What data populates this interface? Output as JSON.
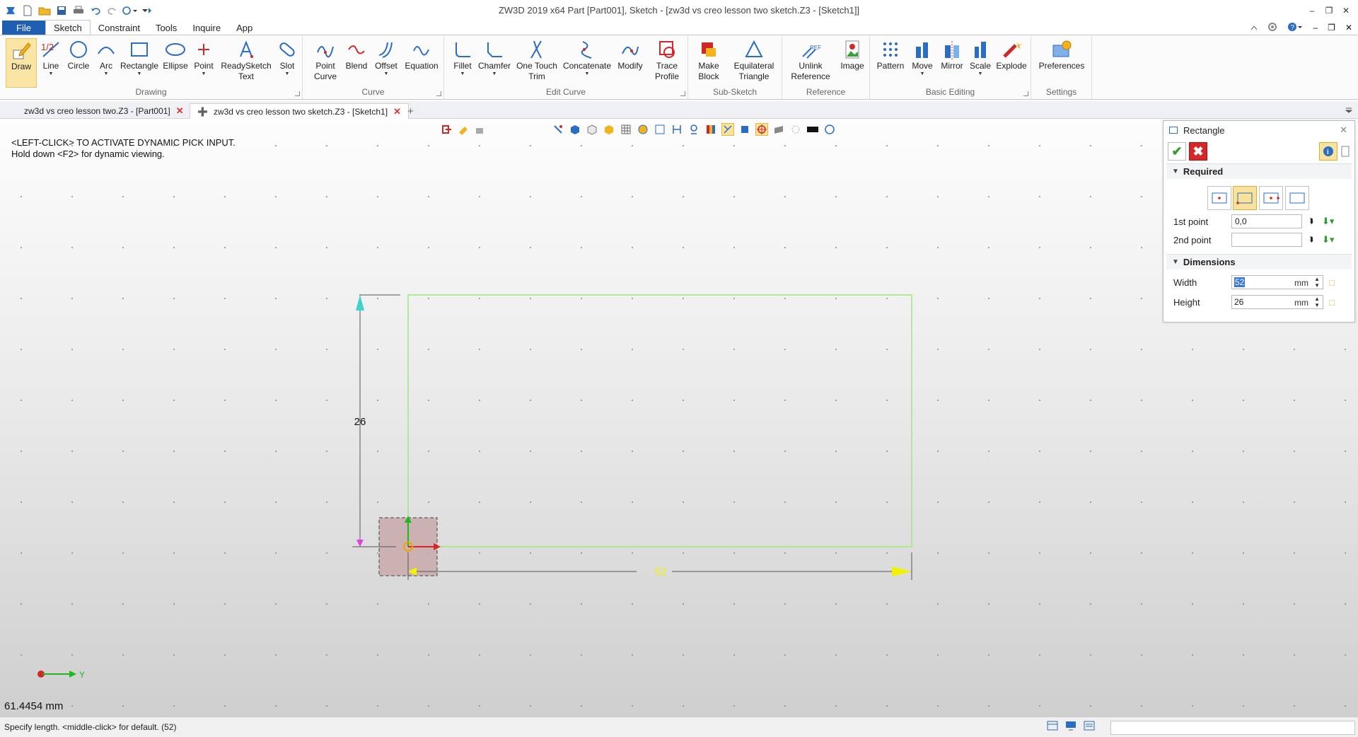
{
  "window": {
    "title": "ZW3D 2019  x64          Part [Part001],  Sketch - [zw3d vs creo lesson two sketch.Z3 - [Sketch1]]"
  },
  "menu": {
    "tabs": [
      "File",
      "Sketch",
      "Constraint",
      "Tools",
      "Inquire",
      "App"
    ],
    "active": "Sketch"
  },
  "ribbon": {
    "groups": {
      "drawing": "Drawing",
      "curve": "Curve",
      "edit_curve": "Edit Curve",
      "sub_sketch": "Sub-Sketch",
      "reference": "Reference",
      "basic_editing": "Basic Editing",
      "settings": "Settings"
    },
    "tools": {
      "draw": "Draw",
      "line": "Line",
      "circle": "Circle",
      "arc": "Arc",
      "rectangle": "Rectangle",
      "ellipse": "Ellipse",
      "point": "Point",
      "readysketch_1": "ReadySketch",
      "readysketch_2": "Text",
      "slot": "Slot",
      "point_curve_1": "Point",
      "point_curve_2": "Curve",
      "blend": "Blend",
      "offset": "Offset",
      "equation": "Equation",
      "fillet": "Fillet",
      "chamfer": "Chamfer",
      "trim_1": "One Touch",
      "trim_2": "Trim",
      "concatenate": "Concatenate",
      "modify": "Modify",
      "trace_1": "Trace",
      "trace_2": "Profile",
      "make_block_1": "Make",
      "make_block_2": "Block",
      "equi_1": "Equilateral",
      "equi_2": "Triangle",
      "unlink_1": "Unlink",
      "unlink_2": "Reference",
      "image": "Image",
      "pattern": "Pattern",
      "move": "Move",
      "mirror": "Mirror",
      "scale": "Scale",
      "explode": "Explode",
      "preferences": "Preferences"
    }
  },
  "doc_tabs": [
    {
      "label": "zw3d vs creo lesson two.Z3 - [Part001]"
    },
    {
      "label": "zw3d vs creo lesson two sketch.Z3 - [Sketch1]"
    }
  ],
  "viewport": {
    "prompt_line1": "<LEFT-CLICK> TO ACTIVATE DYNAMIC PICK INPUT.",
    "prompt_line2": "Hold down <F2> for dynamic viewing.",
    "dim_height": "26",
    "dim_width": "52",
    "axis_label": "Y",
    "readout": "61.4454 mm"
  },
  "panel": {
    "title": "Rectangle",
    "section_required": "Required",
    "first_point_label": "1st point",
    "first_point_value": "0,0",
    "second_point_label": "2nd point",
    "second_point_value": "",
    "section_dimensions": "Dimensions",
    "width_label": "Width",
    "width_value": "52",
    "height_label": "Height",
    "height_value": "26",
    "unit": "mm"
  },
  "status": {
    "text": "Specify length.  <middle-click> for default. (52)"
  },
  "colors": {
    "file_tab": "#1e5fb4",
    "sketch_rect": "#9ee87a",
    "dim_arrow_width": "#f2f200",
    "dim_arrow_height": "#3fd0d0",
    "accept": "#2e9e2e",
    "cancel": "#d62828"
  }
}
